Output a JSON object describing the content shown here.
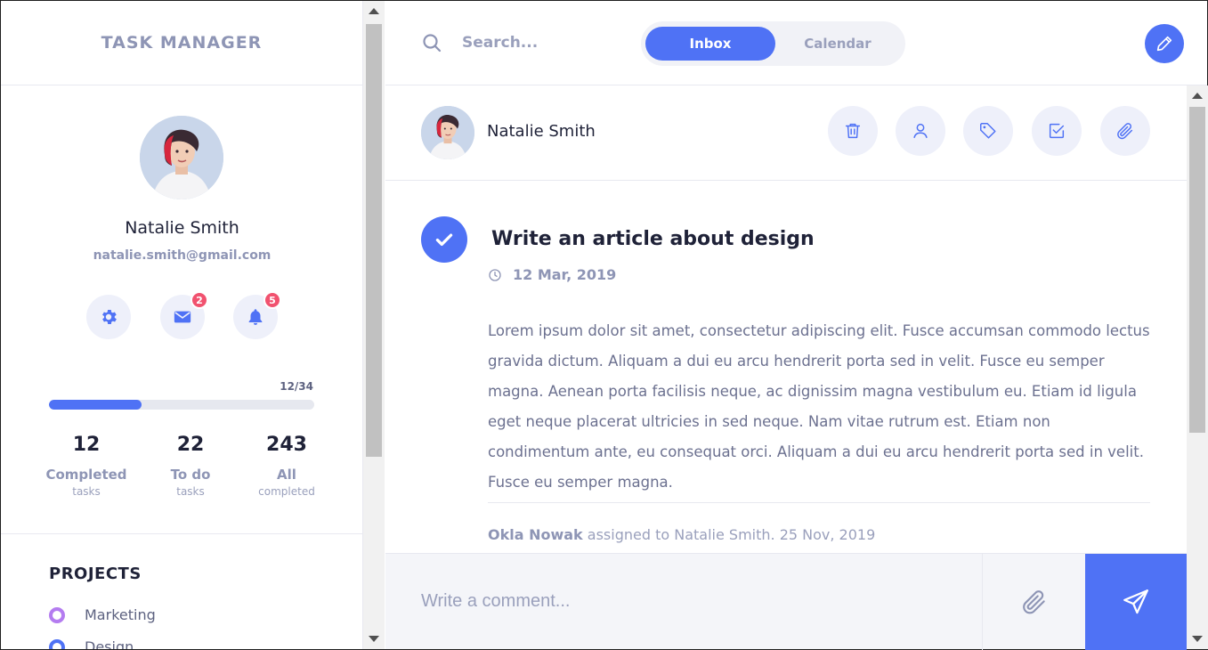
{
  "app": {
    "title": "TASK MANAGER"
  },
  "profile": {
    "name": "Natalie Smith",
    "email": "natalie.smith@gmail.com",
    "messages_badge": "2",
    "notifications_badge": "5",
    "progress_text": "12/34",
    "progress_fraction": 0.35,
    "stats": [
      {
        "value": "12",
        "label": "Completed",
        "sub": "tasks"
      },
      {
        "value": "22",
        "label": "To do",
        "sub": "tasks"
      },
      {
        "value": "243",
        "label": "All",
        "sub": "completed"
      }
    ]
  },
  "projects": {
    "heading": "PROJECTS",
    "items": [
      {
        "label": "Marketing",
        "color": "#b47cf0"
      },
      {
        "label": "Design",
        "color": "#4f72f5"
      }
    ]
  },
  "topbar": {
    "search_placeholder": "Search...",
    "tabs": [
      {
        "label": "Inbox",
        "active": true
      },
      {
        "label": "Calendar",
        "active": false
      }
    ]
  },
  "task": {
    "assignee": "Natalie Smith",
    "title": "Write an article about design",
    "date": "12 Mar, 2019",
    "description": "Lorem ipsum dolor sit amet, consectetur adipiscing elit. Fusce accumsan commodo lectus gravida dictum. Aliquam a dui eu arcu hendrerit porta sed in velit. Fusce eu semper magna. Aenean porta facilisis neque, ac dignissim magna vestibulum eu. Etiam id ligula eget neque placerat ultricies in sed neque. Nam vitae rutrum est. Etiam non condimentum ante, eu consequat orci. Aliquam a dui eu arcu hendrerit porta sed in velit. Fusce eu semper magna.",
    "history_author": "Okla Nowak",
    "history_text": " assigned to Natalie Smith. 25 Nov, 2019",
    "actions": [
      "trash-icon",
      "user-icon",
      "tag-icon",
      "checkbox-icon",
      "paperclip-icon"
    ]
  },
  "comment": {
    "placeholder": "Write a comment..."
  },
  "colors": {
    "accent": "#4f72f5",
    "badge": "#f1526f",
    "muted": "#8e95b5"
  }
}
